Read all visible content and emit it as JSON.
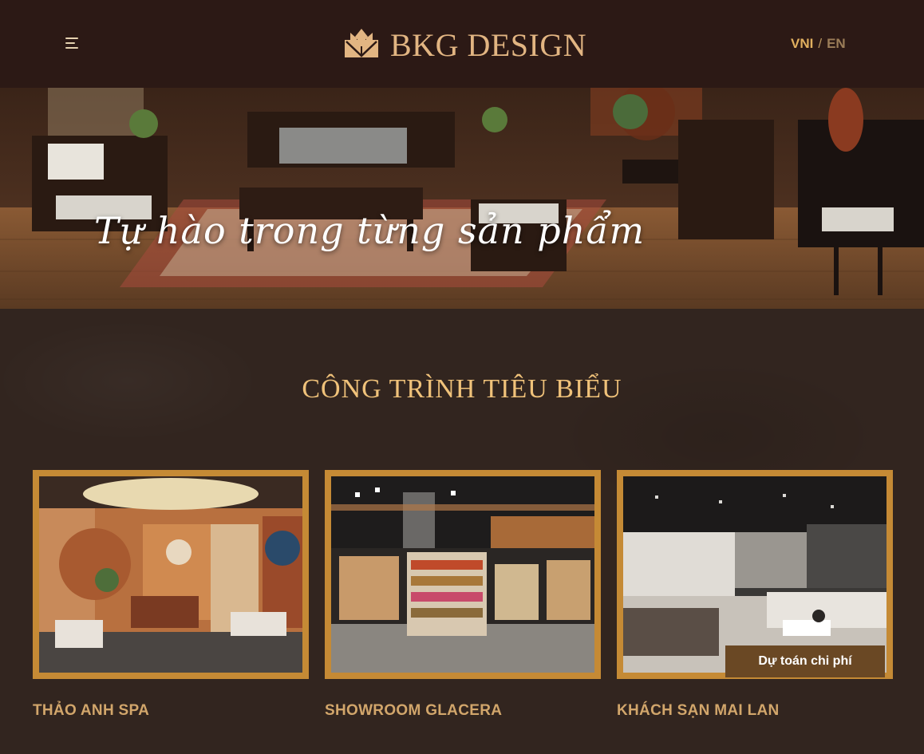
{
  "header": {
    "menu_icon": "hamburger-menu-icon",
    "logo_text": "BKG DESIGN",
    "lang_active": "VNI",
    "lang_separator": "/",
    "lang_other": "EN"
  },
  "hero": {
    "tagline": "Tự hào trong từng sản phẩm"
  },
  "section": {
    "title": "CÔNG TRÌNH TIÊU BIỂU",
    "projects": [
      {
        "title": "THẢO ANH SPA"
      },
      {
        "title": "SHOWROOM GLACERA"
      },
      {
        "title": "KHÁCH SẠN MAI LAN"
      }
    ],
    "estimate_button": "Dự toán chi phí"
  },
  "colors": {
    "header_bg": "#2c1915",
    "section_bg": "#32251f",
    "gold": "#f0c27a",
    "card_border": "#c58a35",
    "lang_active": "#e1b05f"
  }
}
